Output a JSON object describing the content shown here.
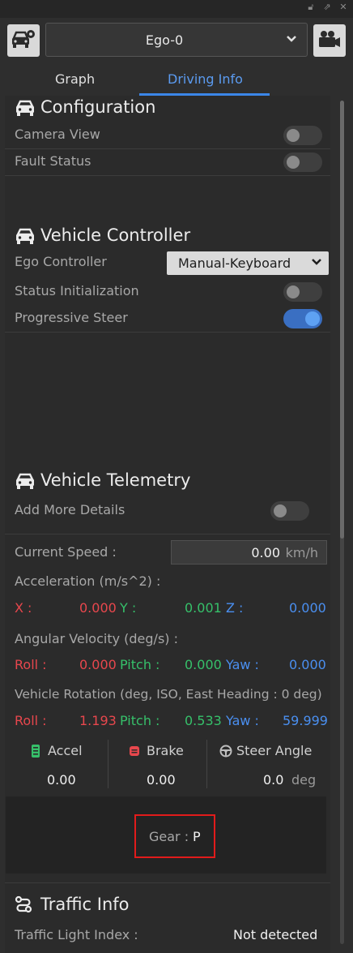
{
  "header": {
    "selected_vehicle": "Ego-0"
  },
  "tabs": [
    {
      "label": "Graph",
      "active": false
    },
    {
      "label": "Driving Info",
      "active": true
    }
  ],
  "configuration": {
    "title": "Configuration",
    "camera_view": {
      "label": "Camera View",
      "on": false
    },
    "fault_status": {
      "label": "Fault Status",
      "on": false
    }
  },
  "vehicle_controller": {
    "title": "Vehicle Controller",
    "ego_controller": {
      "label": "Ego Controller",
      "value": "Manual-Keyboard"
    },
    "status_initialization": {
      "label": "Status Initialization",
      "on": false
    },
    "progressive_steer": {
      "label": "Progressive Steer",
      "on": true
    }
  },
  "telemetry": {
    "title": "Vehicle Telemetry",
    "add_more_details": {
      "label": "Add More Details",
      "on": false
    },
    "current_speed": {
      "label": "Current Speed :",
      "value": "0.00",
      "unit": "km/h"
    },
    "acceleration": {
      "label": "Acceleration (m/s^2) :",
      "x_label": "X :",
      "x": "0.000",
      "y_label": "Y :",
      "y": "0.001",
      "z_label": "Z :",
      "z": "0.000"
    },
    "angular_velocity": {
      "label": "Angular Velocity (deg/s) :",
      "roll_label": "Roll :",
      "roll": "0.000",
      "pitch_label": "Pitch :",
      "pitch": "0.000",
      "yaw_label": "Yaw :",
      "yaw": "0.000"
    },
    "rotation": {
      "label": "Vehicle Rotation (deg, ISO, East Heading : 0 deg)",
      "roll_label": "Roll :",
      "roll": "1.193",
      "pitch_label": "Pitch :",
      "pitch": "0.533",
      "yaw_label": "Yaw :",
      "yaw": "59.999"
    },
    "accel": {
      "label": "Accel",
      "value": "0.00"
    },
    "brake": {
      "label": "Brake",
      "value": "0.00"
    },
    "steer": {
      "label": "Steer Angle",
      "value": "0.0",
      "unit": "deg"
    },
    "gear": {
      "label": "Gear :",
      "value": "P"
    }
  },
  "traffic": {
    "title": "Traffic Info",
    "light_index": {
      "label": "Traffic Light Index :",
      "value": "Not detected"
    }
  },
  "colors": {
    "accent": "#3b86e8",
    "red": "#e8474d",
    "green": "#36c06a",
    "blue": "#4a8ff0",
    "highlight": "#e11b1b"
  }
}
